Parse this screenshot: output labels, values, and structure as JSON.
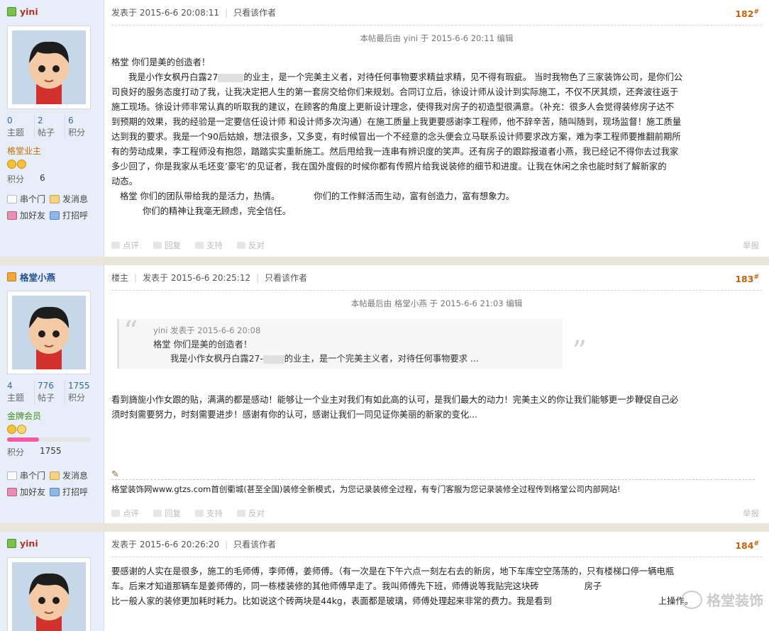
{
  "labels": {
    "posted_at_prefix": "发表于",
    "only_author": "只看该作者",
    "topics": "主题",
    "posts": "帖子",
    "points": "积分",
    "chuan_men": "串个门",
    "send_msg": "发消息",
    "add_friend": "加好友",
    "say_hello": "打招呼",
    "rate": "点评",
    "reply": "回复",
    "support": "支持",
    "oppose": "反对",
    "report": "举报",
    "floor_suffix": "#"
  },
  "posts": [
    {
      "author": "yini",
      "stats": {
        "topics": "0",
        "posts": "2",
        "points": "6"
      },
      "group": "格堂业主",
      "jifen_label": "积分",
      "jifen_value": "6",
      "time": "2015-6-6 20:08:11",
      "floor": "182",
      "edit_note": "本帖最后由 yini 于 2015-6-6 20:11 编辑",
      "content_lines": [
        "格堂 你们是美的创造者！",
        "我是小作女枫丹白露27",
        "的业主，是一个完美主义者，对待任何事物要求精益求精，见不得有瑕疵。 当时我物色了三家装饰公司，是你们公",
        "司良好的服务态度打动了我，让我决定把人生的第一套房交给你们来规划。合同订立后，徐设计师从设计到实际施工，不仅不厌其烦，还奔波往返于",
        "施工现场。徐设计师非常认真的听取我的建议，在顾客的角度上更新设计理念，使得我对房子的初造型很满意。（补充：很多人会觉得装修房子达不",
        "到预期的效果，我的经验是一定要信任设计师 和设计师多次沟通）在施工质量上我更要感谢李工程师，他不辞辛苦，随叫随到，现场监督！施工质量",
        "达到我的要求。我是一个90后姑娘，想法很多，又多变，有时候冒出一个不经意的念头便会立马联系设计师要求改方案，难为李工程师要推翻前期所",
        "有的劳动成果，李工程师没有抱怨，踏踏实实重新施工。然后甩给我一连串有辨识度的笑声。还有房子的跟踪报道者小燕，我已经记不得你去过我家",
        "多少回了，你是我家从毛坯变’豪宅’的见证者，我在国外度假的时候你都有传照片给我说装修的细节和进度。让我在休闲之余也能时刻了解新家的",
        "动态。",
        "格堂 你们的团队带给我的是活力，热情。",
        "你们的工作鲜活而生动，富有创造力，富有想象力。",
        "你们的精神让我毫无顾虑，完全信任。"
      ]
    },
    {
      "author": "格堂小燕",
      "stats": {
        "topics": "4",
        "posts": "776",
        "points": "1755"
      },
      "group": "金牌会员",
      "jifen_label": "积分",
      "jifen_value": "1755",
      "level_progress": 0.38,
      "op_label": "楼主",
      "time": "2015-6-6 20:25:12",
      "floor": "183",
      "edit_note": "本帖最后由 格堂小燕 于 2015-6-6 21:03 编辑",
      "quote": {
        "author_line": "yini 发表于 2015-6-6 20:08",
        "line1": "格堂 你们是美的创造者！",
        "line2_a": "我是小作女枫丹白露27-",
        "line2_b": "的业主，是一个完美主义者，对待任何事物要求 ..."
      },
      "content_lines": [
        "看到旖旎小作女跟的贴，满满的都是感动！能够让一个业主对我们有如此高的认可，是我们最大的动力！完美主义的你让我们能够更一步鞭促自己必",
        "须时刻需要努力，时刻需要进步！感谢有你的认可，感谢让我们一同见证你美丽的新家的变化..."
      ],
      "signature": "格堂装饰网www.gtzs.com首创衢城(甚至全国)装修全新模式，为您记录装修全过程，有专门客服为您记录装修全过程传到格堂公司内部网站!"
    },
    {
      "author": "yini",
      "time": "2015-6-6 20:26:20",
      "floor": "184",
      "content_lines": [
        "要感谢的人实在是很多，施工的毛师傅，李师傅，姜师傅。（有一次是在下午六点一刻左右去的新房，地下车库空空荡荡的，只有楼梯口停一辆电瓶",
        "车。后来才知道那辆车是姜师傅的，同一栋楼装修的其他师傅早走了。我叫师傅先下班，师傅说等我贴完这块砖",
        "房子",
        "比一般人家的装修更加耗时耗力。比如说这个砖两块是44kg，表面都是玻璃，师傅处理起来非常的费力。我是看到",
        "上操作。"
      ],
      "watermark": "格堂装饰"
    }
  ],
  "colors": {
    "sidebar_bg": "#e8eef7",
    "page_bg": "#e9e5da",
    "floor_color": "#c0630d",
    "name_blue": "#1f4e8c",
    "name_red": "#b0332a"
  }
}
